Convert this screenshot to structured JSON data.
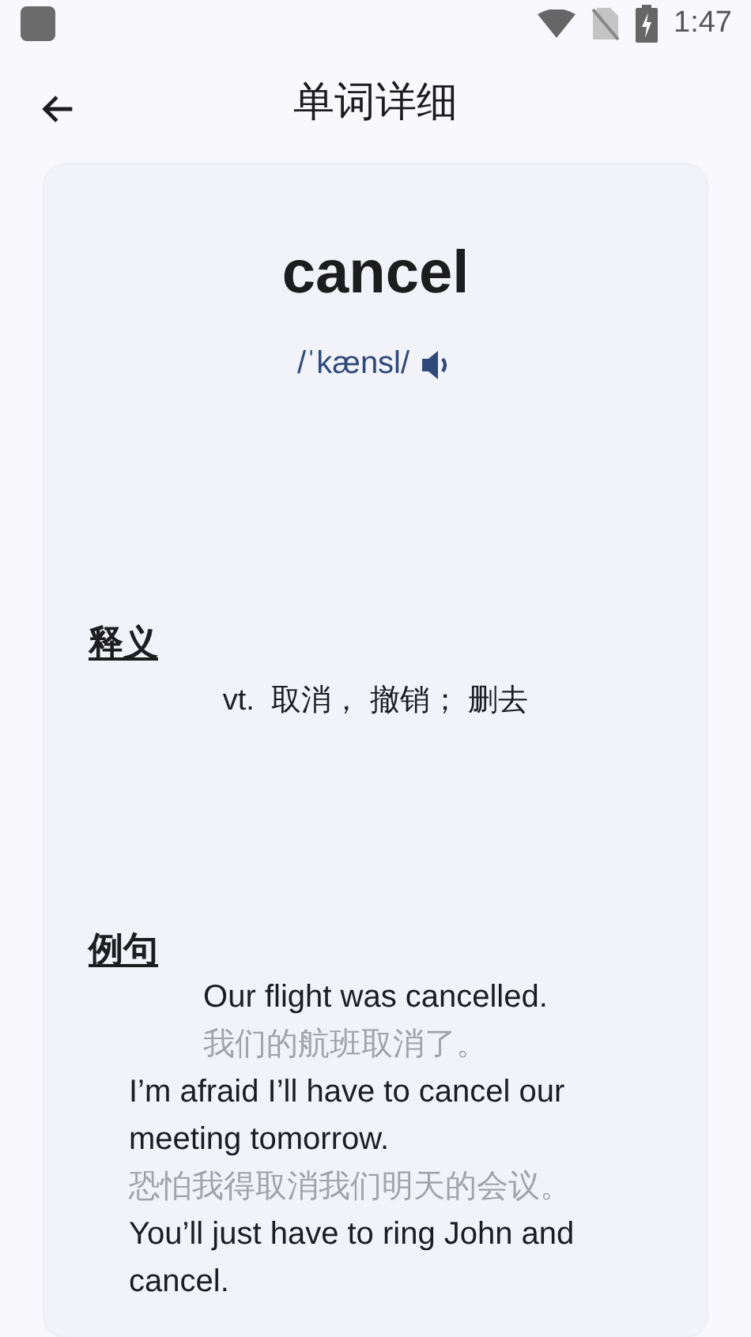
{
  "status_bar": {
    "time": "1:47"
  },
  "app_bar": {
    "title": "单词详细"
  },
  "word": {
    "headword": "cancel",
    "phonetic": "/ˈkænsl/"
  },
  "definition": {
    "heading": "释义",
    "text": "vt.  取消， 撤销； 删去"
  },
  "examples": {
    "heading": "例句",
    "items": [
      {
        "english": "Our flight was cancelled.",
        "chinese": "我们的航班取消了。"
      },
      {
        "english": "I’m afraid I’ll have to cancel our meeting tomorrow.",
        "chinese": "恐怕我得取消我们明天的会议。"
      },
      {
        "english": "You’ll just have to ring John and cancel."
      }
    ]
  }
}
